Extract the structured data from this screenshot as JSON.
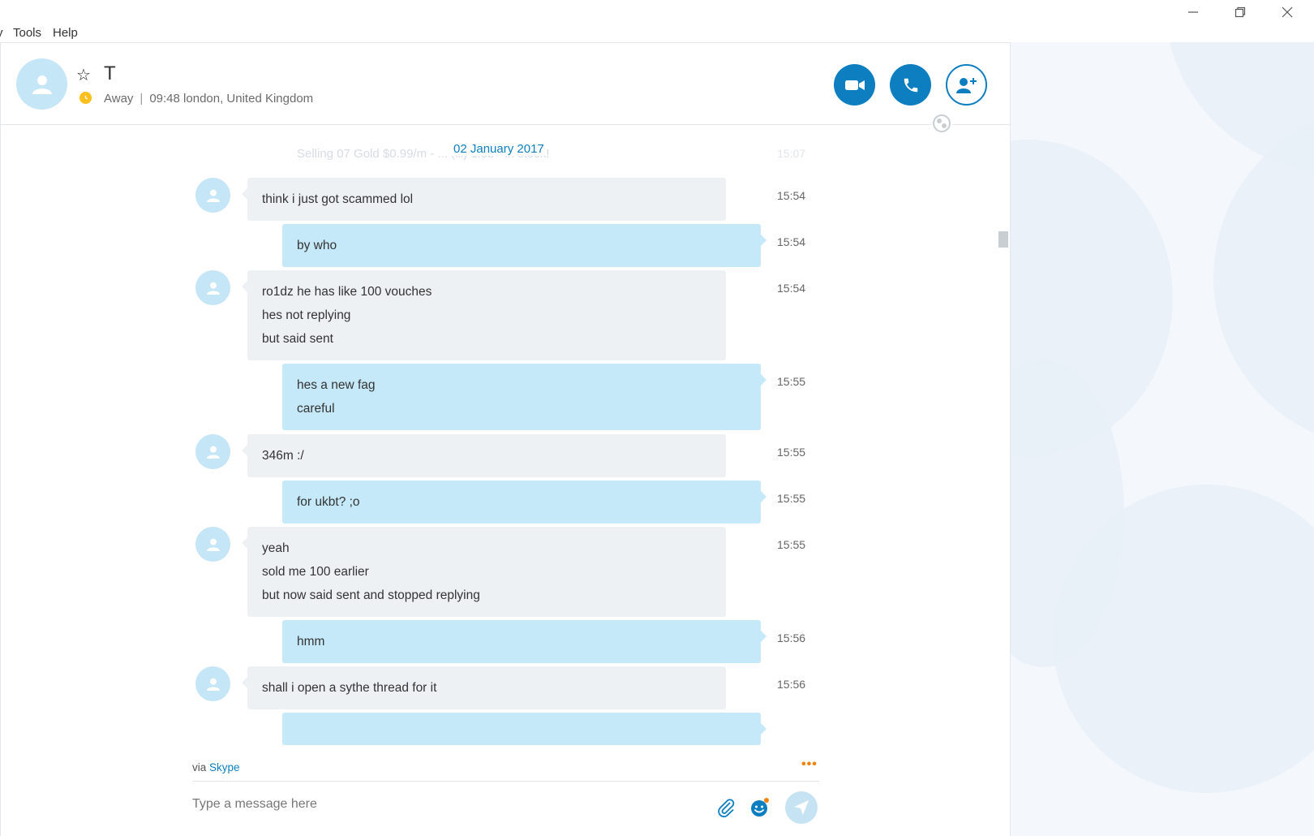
{
  "menu": {
    "items": [
      {
        "label": "Tools"
      },
      {
        "label": "Help"
      }
    ]
  },
  "window": {
    "minimize_icon": "minimize-icon",
    "restore_icon": "restore-icon",
    "close_icon": "close-icon"
  },
  "contact": {
    "name": "T",
    "status": "Away",
    "local_time": "09:48",
    "location": "london, United Kingdom",
    "status_color": "#ffc01e"
  },
  "header_actions": {
    "video_icon": "video-call-icon",
    "call_icon": "phone-icon",
    "add_icon": "add-person-icon"
  },
  "colors": {
    "accent": "#0d7ebf",
    "incoming_bubble": "#eef1f4",
    "outgoing_bubble": "#c5e9f8",
    "avatar": "#c4e6f7"
  },
  "conversation": {
    "faded_message": "Selling 07 Gold $0.99/m - ... (ill) 1.5b+ in stock!",
    "faded_time": "15:07",
    "date_separator": "02 January 2017",
    "messages": [
      {
        "dir": "in",
        "lines": [
          "think i just got scammed lol"
        ],
        "time": "15:54"
      },
      {
        "dir": "out",
        "lines": [
          "by who"
        ],
        "time": "15:54"
      },
      {
        "dir": "in",
        "lines": [
          "ro1dz he has like 100 vouches",
          "hes not replying",
          "but said sent"
        ],
        "time": "15:54"
      },
      {
        "dir": "out",
        "lines": [
          "hes a new fag",
          "careful"
        ],
        "time": "15:55"
      },
      {
        "dir": "in",
        "lines": [
          "346m :/"
        ],
        "time": "15:55"
      },
      {
        "dir": "out",
        "lines": [
          "for ukbt? ;o"
        ],
        "time": "15:55"
      },
      {
        "dir": "in",
        "lines": [
          "yeah",
          "sold me 100 earlier",
          "but now said sent and stopped replying"
        ],
        "time": "15:55"
      },
      {
        "dir": "out",
        "lines": [
          "hmm"
        ],
        "time": "15:56"
      },
      {
        "dir": "in",
        "lines": [
          "shall i open a sythe thread for it"
        ],
        "time": "15:56"
      }
    ]
  },
  "composer": {
    "via_prefix": "via",
    "via_link": "Skype",
    "more_label": "•••",
    "placeholder": "Type a message here"
  }
}
